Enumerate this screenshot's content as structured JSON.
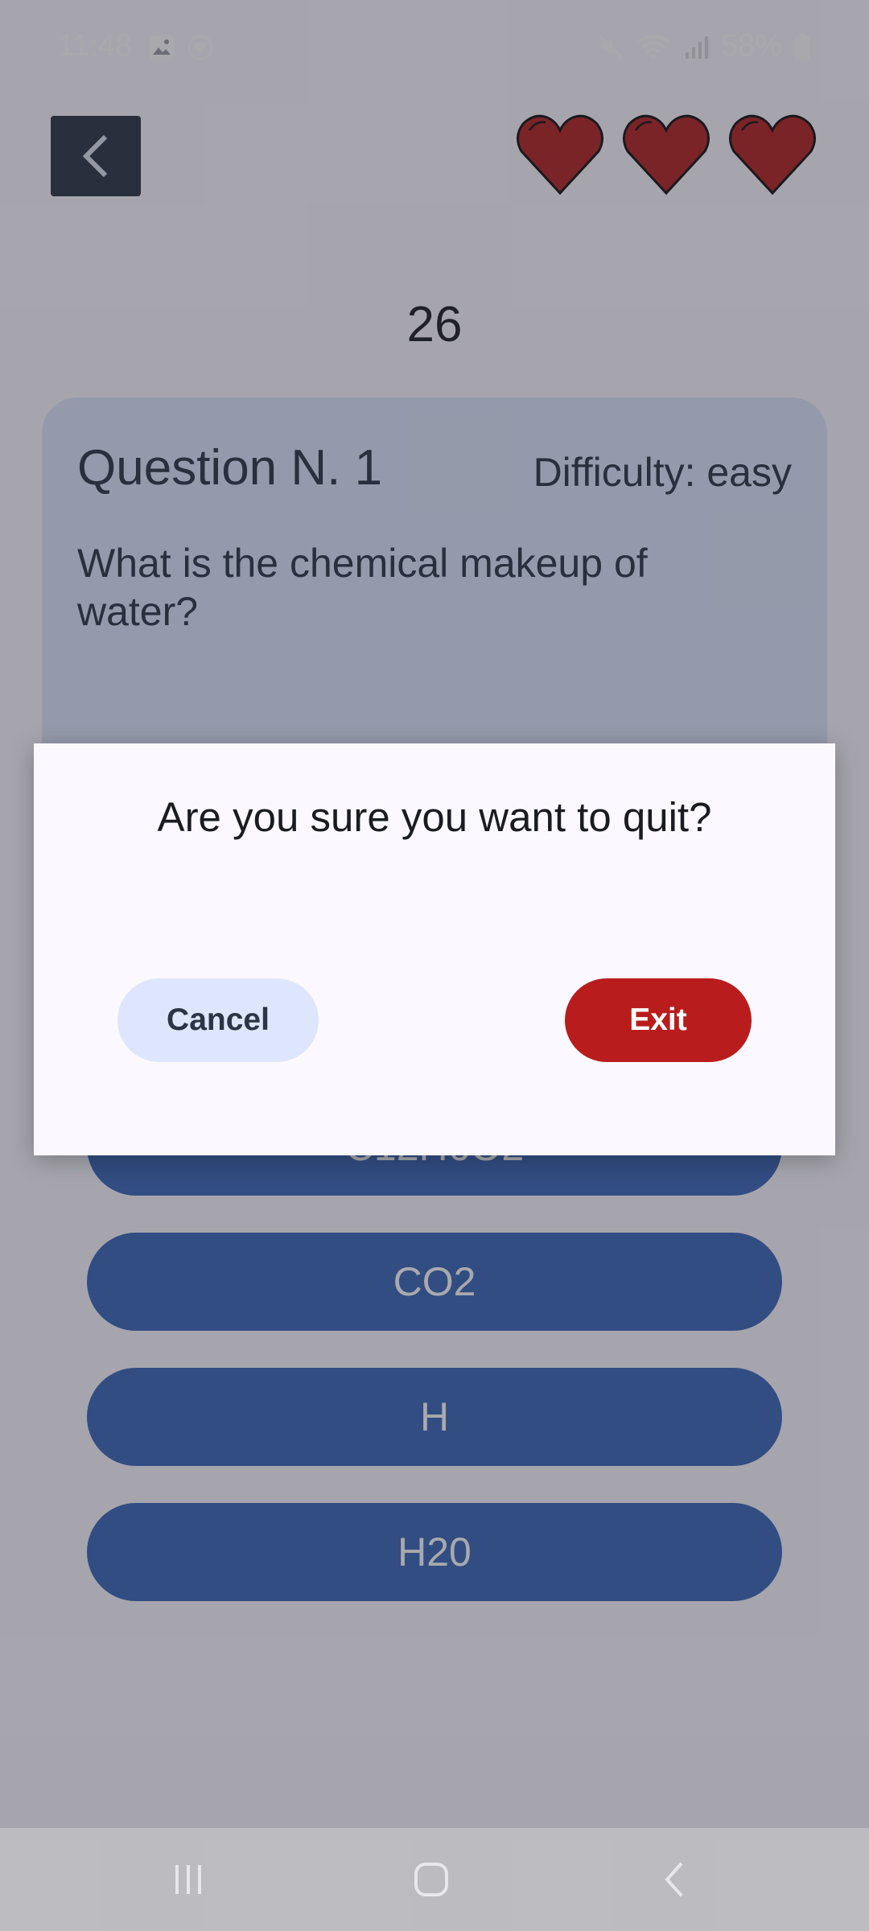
{
  "status": {
    "time": "11:48",
    "battery": "58%"
  },
  "score": "26",
  "lives": {
    "count": 3
  },
  "question": {
    "title": "Question N. 1",
    "difficulty": "Difficulty: easy",
    "text": "What is the chemical makeup of water?"
  },
  "answers": [
    "C12H6O2",
    "CO2",
    "H",
    "H20"
  ],
  "dialog": {
    "title": "Are you sure you want to quit?",
    "cancel_label": "Cancel",
    "exit_label": "Exit"
  },
  "colors": {
    "accent": "#b91c1c",
    "answer_bg": "#3a67b8",
    "card_bg": "#dde6fc",
    "back_bg": "#2b3545",
    "heart": "#b22222"
  }
}
